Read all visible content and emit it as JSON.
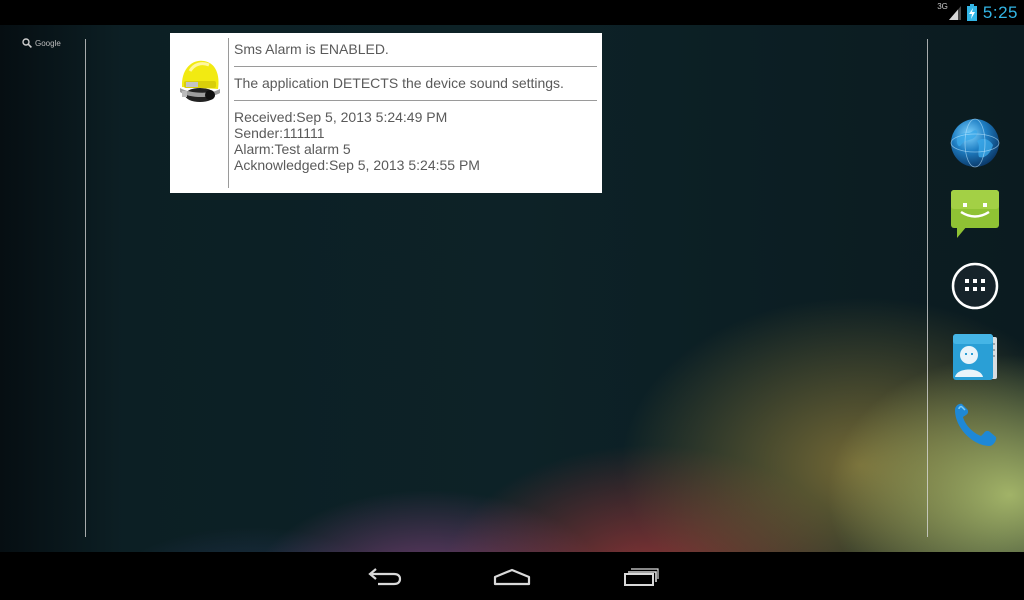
{
  "status_bar": {
    "network_type": "3G",
    "time": "5:25",
    "icons": [
      "signal-icon",
      "battery-charging-icon"
    ]
  },
  "search_widget": {
    "label": "Google",
    "icon": "search-icon"
  },
  "alarm_widget": {
    "icon": "firefighter-helmet-icon",
    "status_line": "Sms Alarm is ENABLED.",
    "sound_line": "The application DETECTS the device sound settings.",
    "received": "Received:Sep 5, 2013 5:24:49 PM",
    "sender": "Sender:111111",
    "alarm": "Alarm:Test alarm 5",
    "acknowledged": "Acknowledged:Sep 5, 2013 5:24:55 PM"
  },
  "dock": {
    "items": [
      {
        "name": "browser",
        "icon": "globe-icon"
      },
      {
        "name": "messaging",
        "icon": "messaging-icon"
      },
      {
        "name": "all-apps",
        "icon": "app-drawer-icon"
      },
      {
        "name": "people",
        "icon": "contacts-icon"
      },
      {
        "name": "phone",
        "icon": "phone-icon"
      }
    ]
  },
  "nav_bar": {
    "buttons": [
      "back-icon",
      "home-icon",
      "recent-apps-icon"
    ]
  },
  "colors": {
    "clock": "#33b5e5",
    "widget_bg": "#ffffff",
    "widget_text": "#5a5a5a",
    "bars": "#000000"
  }
}
